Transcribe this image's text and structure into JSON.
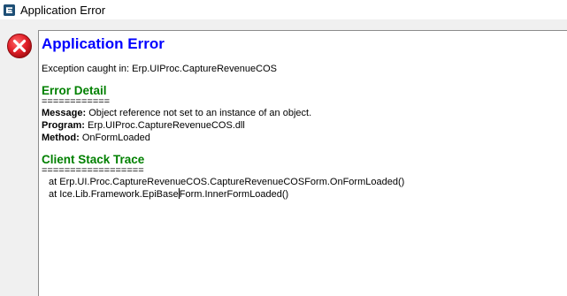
{
  "window": {
    "title": "Application Error",
    "logo_letter": "e"
  },
  "error": {
    "heading": "Application Error",
    "exception_line": "Exception caught in: Erp.UIProc.CaptureRevenueCOS"
  },
  "error_detail": {
    "heading": "Error Detail",
    "separator": "============",
    "message_label": "Message:",
    "message_value": " Object reference not set to an instance of an object.",
    "program_label": "Program:",
    "program_value": " Erp.UIProc.CaptureRevenueCOS.dll",
    "method_label": "Method:",
    "method_value": " OnFormLoaded"
  },
  "stack_trace": {
    "heading": "Client Stack Trace",
    "separator": "==================",
    "line1": "at Erp.UI.Proc.CaptureRevenueCOS.CaptureRevenueCOSForm.OnFormLoaded()",
    "line2_before_caret": "at Ice.Lib.Framework.EpiBase",
    "line2_after_caret": "Form.InnerFormLoaded()"
  },
  "colors": {
    "heading_blue": "#0000ff",
    "section_green": "#008000",
    "error_red": "#d4161c"
  }
}
